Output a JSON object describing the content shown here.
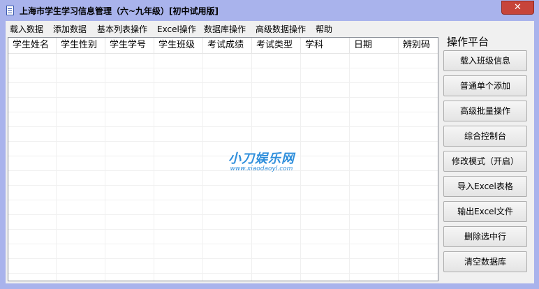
{
  "window": {
    "title": "上海市学生学习信息管理（六~九年级）[初中试用版]",
    "close_glyph": "✕"
  },
  "menu": {
    "items": [
      {
        "label": "载入数据"
      },
      {
        "label": "添加数据"
      },
      {
        "label": "基本列表操作"
      },
      {
        "label": "Excel操作"
      },
      {
        "label": "数据库操作"
      },
      {
        "label": "高级数据操作"
      },
      {
        "label": "帮助"
      }
    ]
  },
  "grid": {
    "columns": [
      "学生姓名",
      "学生性别",
      "学生学号",
      "学生班级",
      "考试成绩",
      "考试类型",
      "学科",
      "日期",
      "辨别码"
    ],
    "rows": []
  },
  "watermark": {
    "main": "小刀娱乐网",
    "sub": "www.xiaodaoyl.com"
  },
  "panel": {
    "title": "操作平台",
    "buttons": [
      {
        "label": "载入班级信息"
      },
      {
        "label": "普通单个添加"
      },
      {
        "label": "高级批量操作"
      },
      {
        "label": "综合控制台"
      },
      {
        "label": "修改模式（开启）"
      },
      {
        "label": "导入Excel表格"
      },
      {
        "label": "输出Excel文件"
      },
      {
        "label": "删除选中行"
      },
      {
        "label": "清空数据库"
      }
    ]
  }
}
